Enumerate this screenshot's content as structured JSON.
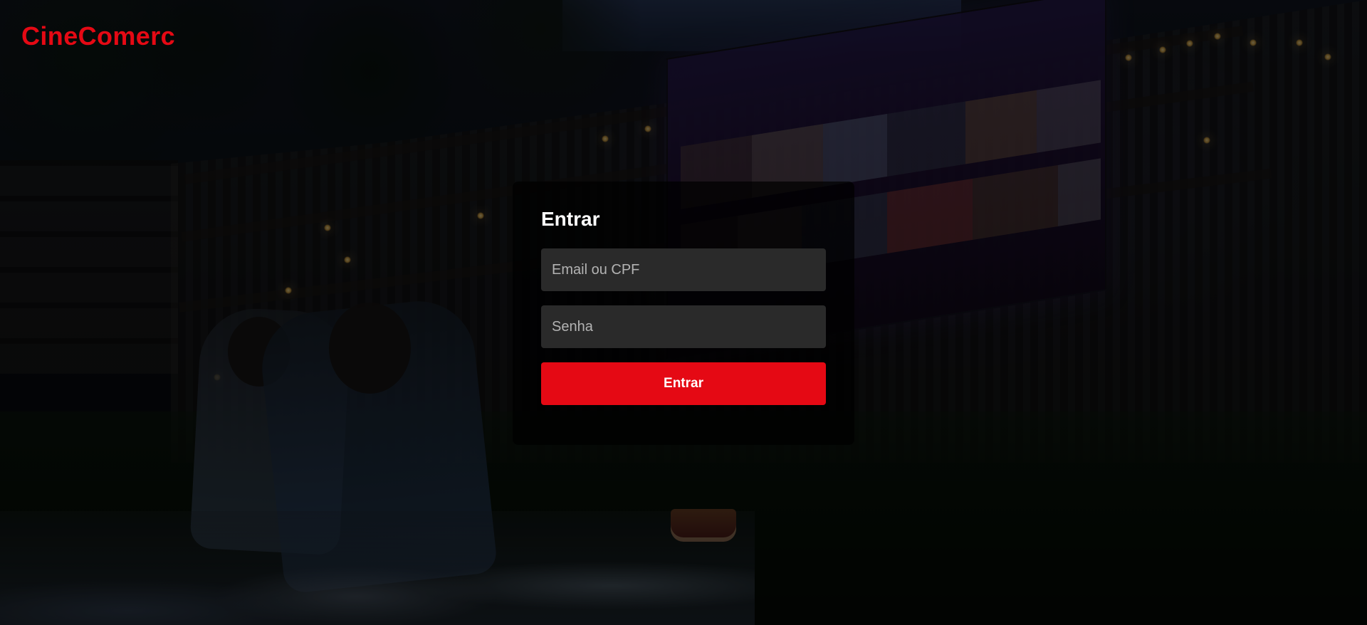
{
  "brand": {
    "name": "CineComerc",
    "accent": "#e50914"
  },
  "login": {
    "title": "Entrar",
    "email_placeholder": "Email ou CPF",
    "password_placeholder": "Senha",
    "submit_label": "Entrar"
  }
}
